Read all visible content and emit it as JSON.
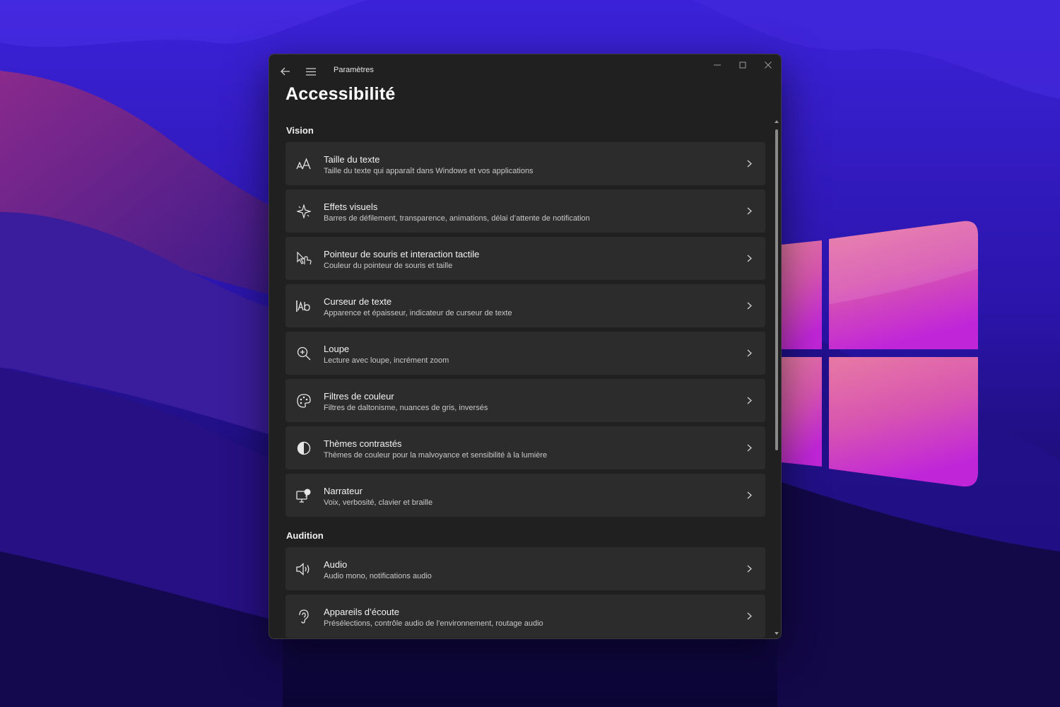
{
  "window": {
    "app_title": "Paramètres",
    "back_icon": "back-arrow-icon",
    "menu_icon": "hamburger-menu-icon"
  },
  "page": {
    "title": "Accessibilité"
  },
  "sections": [
    {
      "title": "Vision",
      "items": [
        {
          "icon": "text-size-icon",
          "title": "Taille du texte",
          "subtitle": "Taille du texte qui apparaît dans Windows et vos applications"
        },
        {
          "icon": "sparkle-icon",
          "title": "Effets visuels",
          "subtitle": "Barres de défilement, transparence, animations, délai d’attente de notification"
        },
        {
          "icon": "mouse-touch-icon",
          "title": "Pointeur de souris et interaction tactile",
          "subtitle": "Couleur du pointeur de souris et taille"
        },
        {
          "icon": "text-cursor-icon",
          "title": "Curseur de texte",
          "subtitle": "Apparence et épaisseur, indicateur de curseur de texte"
        },
        {
          "icon": "magnifier-icon",
          "title": "Loupe",
          "subtitle": "Lecture avec loupe, incrément zoom"
        },
        {
          "icon": "palette-icon",
          "title": "Filtres de couleur",
          "subtitle": "Filtres de daltonisme, nuances de gris, inversés"
        },
        {
          "icon": "contrast-icon",
          "title": "Thèmes contrastés",
          "subtitle": "Thèmes de couleur pour la malvoyance et sensibilité à la lumière"
        },
        {
          "icon": "narrator-icon",
          "title": "Narrateur",
          "subtitle": "Voix, verbosité, clavier et braille"
        }
      ]
    },
    {
      "title": "Audition",
      "items": [
        {
          "icon": "speaker-icon",
          "title": "Audio",
          "subtitle": "Audio mono, notifications audio"
        },
        {
          "icon": "hearing-device-icon",
          "title": "Appareils d’écoute",
          "subtitle": "Présélections, contrôle audio de l’environnement, routage audio"
        }
      ]
    }
  ],
  "colors": {
    "window_bg": "#202020",
    "card_bg": "#2c2c2c",
    "text_primary": "#f3f3f3",
    "text_secondary": "#c9c9c9",
    "wallpaper_blue": "#3a1fd0",
    "wallpaper_pink": "#d0509c"
  }
}
